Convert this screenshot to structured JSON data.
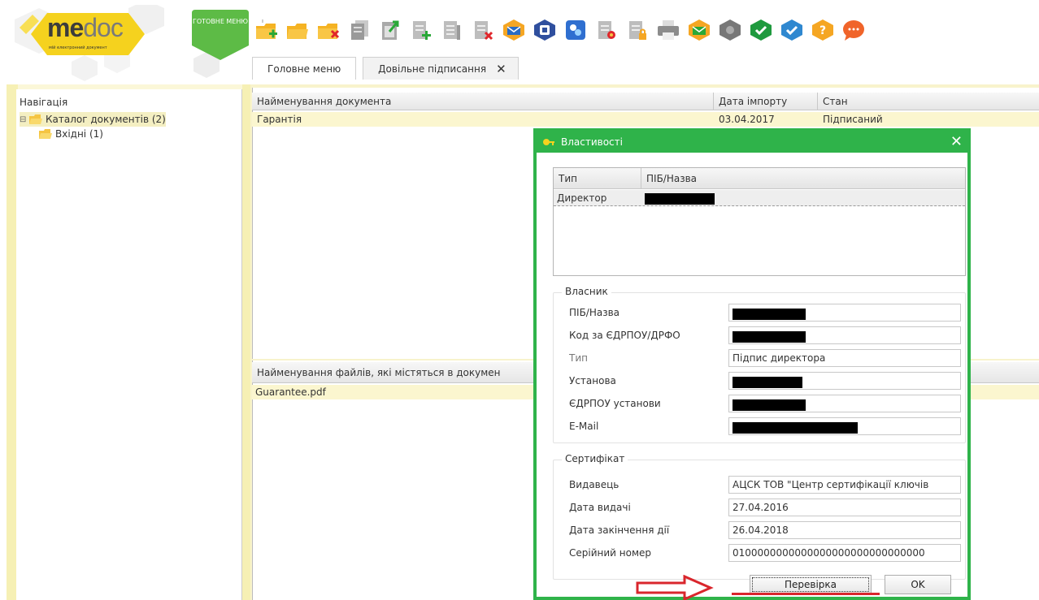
{
  "app": {
    "logo_me": "me",
    "logo_doc": "doc",
    "logo_tagline": "мій електронний документ",
    "ready_menu_label": "ГОТОВНЕ МЕНЮ"
  },
  "toolbar": {
    "icons": [
      "folder-add-icon",
      "folder-open-icon",
      "folder-delete-icon",
      "copy-icon",
      "export-icon",
      "document-add-icon",
      "document-view-icon",
      "document-delete-icon",
      "send-envelope-icon",
      "sign-shield-icon",
      "encrypt-key-icon",
      "certificate-icon",
      "lock-document-icon",
      "print-icon",
      "receive-envelope-icon",
      "settings-gear-icon",
      "accept-check-icon",
      "verify-check-icon",
      "help-icon",
      "chat-icon"
    ]
  },
  "tabs": [
    {
      "label": "Головне меню",
      "active": false
    },
    {
      "label": "Довільне підписання",
      "active": true
    }
  ],
  "nav": {
    "title": "Навігація",
    "items": [
      {
        "label": "Каталог документів  (2)",
        "level": 0,
        "selected": true
      },
      {
        "label": "Вхідні  (1)",
        "level": 1,
        "selected": false
      }
    ]
  },
  "documents": {
    "columns": [
      "Найменування документа",
      "Дата імпорту",
      "Стан"
    ],
    "rows": [
      {
        "name": "Гарантія",
        "date": "03.04.2017",
        "status": "Підписаний"
      }
    ]
  },
  "files": {
    "header": "Найменування файлів, які містяться в докумен",
    "rows": [
      "Guarantee.pdf"
    ]
  },
  "dialog": {
    "title": "Властивості",
    "signers": {
      "columns": [
        "Тип",
        "ПІБ/Назва"
      ],
      "rows": [
        {
          "type": "Директор"
        }
      ]
    },
    "owner": {
      "legend": "Власник",
      "name_label": "ПІБ/Назва",
      "code_label": "Код за ЄДРПОУ/ДРФО",
      "type_label": "Тип",
      "type_value": "Підпис директора",
      "org_label": "Установа",
      "org_code_label": "ЄДРПОУ установи",
      "email_label": "E-Mail"
    },
    "certificate": {
      "legend": "Сертифікат",
      "issuer_label": "Видавець",
      "issuer_value": "АЦСК ТОВ \"Центр сертифікації ключів",
      "issue_date_label": "Дата видачі",
      "issue_date_value": "27.04.2016",
      "expiry_label": "Дата закінчення дії",
      "expiry_value": "26.04.2018",
      "serial_label": "Серійний номер",
      "serial_value": "0100000000000000000000000000000"
    },
    "verify_button": "Перевірка",
    "ok_button": "OK"
  },
  "colors": {
    "accent_green": "#2fb34a",
    "nav_yellow": "#f6f0b4",
    "highlight_red": "#d9262c"
  }
}
